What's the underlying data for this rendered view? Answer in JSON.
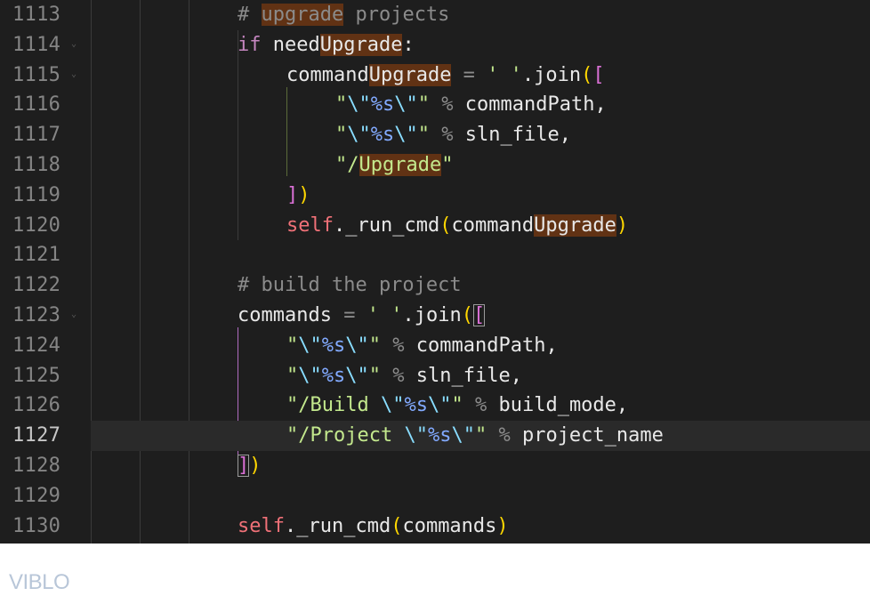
{
  "editor": {
    "colors": {
      "background": "#1e1e1e",
      "comment": "#6a9955",
      "keyword": "#c586c0",
      "string": "#ce9178",
      "escape": "#b5cea8",
      "format": "#9cdcfe",
      "self": "#f44747",
      "identifier": "#d4d4d4",
      "bracket_gold": "#ffd700",
      "bracket_purple": "#da70d6",
      "search_highlight": "#613214"
    },
    "lines": [
      {
        "num": "1113",
        "indent": 4,
        "tokens": [
          {
            "t": "# ",
            "c": "#8b8b8b"
          },
          {
            "t": "upgrade",
            "c": "#8b8b8b",
            "hl": true
          },
          {
            "t": " projects",
            "c": "#8b8b8b"
          }
        ]
      },
      {
        "num": "1114",
        "indent": 4,
        "fold": true,
        "tokens": [
          {
            "t": "if",
            "c": "#c586c0"
          },
          {
            "t": " need",
            "c": "#e8e8e8"
          },
          {
            "t": "Upgrade",
            "c": "#e8e8e8",
            "hl": true
          },
          {
            "t": ":",
            "c": "#e8e8e8"
          }
        ]
      },
      {
        "num": "1115",
        "indent": 8,
        "fold": true,
        "tokens": [
          {
            "t": "command",
            "c": "#e8e8e8"
          },
          {
            "t": "Upgrade",
            "c": "#e8e8e8",
            "hl": true
          },
          {
            "t": " = ",
            "c": "#8b8b8b"
          },
          {
            "t": "' '",
            "c": "#c3e88d"
          },
          {
            "t": ".join",
            "c": "#e8e8e8"
          },
          {
            "t": "(",
            "c": "#ffd700"
          },
          {
            "t": "[",
            "c": "#da70d6"
          }
        ]
      },
      {
        "num": "1116",
        "indent": 12,
        "tokens": [
          {
            "t": "\"",
            "c": "#c3e88d"
          },
          {
            "t": "\\\"",
            "c": "#89ddff"
          },
          {
            "t": "%s",
            "c": "#82aaff"
          },
          {
            "t": "\\\"",
            "c": "#89ddff"
          },
          {
            "t": "\"",
            "c": "#c3e88d"
          },
          {
            "t": " % ",
            "c": "#8b8b8b"
          },
          {
            "t": "commandPath,",
            "c": "#e8e8e8"
          }
        ]
      },
      {
        "num": "1117",
        "indent": 12,
        "tokens": [
          {
            "t": "\"",
            "c": "#c3e88d"
          },
          {
            "t": "\\\"",
            "c": "#89ddff"
          },
          {
            "t": "%s",
            "c": "#82aaff"
          },
          {
            "t": "\\\"",
            "c": "#89ddff"
          },
          {
            "t": "\"",
            "c": "#c3e88d"
          },
          {
            "t": " % ",
            "c": "#8b8b8b"
          },
          {
            "t": "sln_file,",
            "c": "#e8e8e8"
          }
        ]
      },
      {
        "num": "1118",
        "indent": 12,
        "tokens": [
          {
            "t": "\"/",
            "c": "#c3e88d"
          },
          {
            "t": "Upgrade",
            "c": "#c3e88d",
            "hl": true
          },
          {
            "t": "\"",
            "c": "#c3e88d"
          }
        ]
      },
      {
        "num": "1119",
        "indent": 8,
        "tokens": [
          {
            "t": "]",
            "c": "#da70d6"
          },
          {
            "t": ")",
            "c": "#ffd700"
          }
        ]
      },
      {
        "num": "1120",
        "indent": 8,
        "tokens": [
          {
            "t": "self",
            "c": "#f07178"
          },
          {
            "t": "._run_cmd",
            "c": "#e8e8e8"
          },
          {
            "t": "(",
            "c": "#ffd700"
          },
          {
            "t": "command",
            "c": "#e8e8e8"
          },
          {
            "t": "Upgrade",
            "c": "#e8e8e8",
            "hl": true
          },
          {
            "t": ")",
            "c": "#ffd700"
          }
        ]
      },
      {
        "num": "1121",
        "indent": 0,
        "tokens": []
      },
      {
        "num": "1122",
        "indent": 4,
        "tokens": [
          {
            "t": "# build the project",
            "c": "#8b8b8b"
          }
        ]
      },
      {
        "num": "1123",
        "indent": 4,
        "fold": true,
        "tokens": [
          {
            "t": "commands",
            "c": "#e8e8e8"
          },
          {
            "t": " = ",
            "c": "#8b8b8b"
          },
          {
            "t": "' '",
            "c": "#c3e88d"
          },
          {
            "t": ".join",
            "c": "#e8e8e8"
          },
          {
            "t": "(",
            "c": "#ffd700"
          },
          {
            "t": "[",
            "c": "#da70d6",
            "box": true
          }
        ]
      },
      {
        "num": "1124",
        "indent": 8,
        "tokens": [
          {
            "t": "\"",
            "c": "#c3e88d"
          },
          {
            "t": "\\\"",
            "c": "#89ddff"
          },
          {
            "t": "%s",
            "c": "#82aaff"
          },
          {
            "t": "\\\"",
            "c": "#89ddff"
          },
          {
            "t": "\"",
            "c": "#c3e88d"
          },
          {
            "t": " % ",
            "c": "#8b8b8b"
          },
          {
            "t": "commandPath,",
            "c": "#e8e8e8"
          }
        ]
      },
      {
        "num": "1125",
        "indent": 8,
        "tokens": [
          {
            "t": "\"",
            "c": "#c3e88d"
          },
          {
            "t": "\\\"",
            "c": "#89ddff"
          },
          {
            "t": "%s",
            "c": "#82aaff"
          },
          {
            "t": "\\\"",
            "c": "#89ddff"
          },
          {
            "t": "\"",
            "c": "#c3e88d"
          },
          {
            "t": " % ",
            "c": "#8b8b8b"
          },
          {
            "t": "sln_file,",
            "c": "#e8e8e8"
          }
        ]
      },
      {
        "num": "1126",
        "indent": 8,
        "tokens": [
          {
            "t": "\"/Build ",
            "c": "#c3e88d"
          },
          {
            "t": "\\\"",
            "c": "#89ddff"
          },
          {
            "t": "%s",
            "c": "#82aaff"
          },
          {
            "t": "\\\"",
            "c": "#89ddff"
          },
          {
            "t": "\"",
            "c": "#c3e88d"
          },
          {
            "t": " % ",
            "c": "#8b8b8b"
          },
          {
            "t": "build_mode,",
            "c": "#e8e8e8"
          }
        ]
      },
      {
        "num": "1127",
        "indent": 8,
        "current": true,
        "tokens": [
          {
            "t": "\"/Project ",
            "c": "#c3e88d"
          },
          {
            "t": "\\\"",
            "c": "#89ddff"
          },
          {
            "t": "%s",
            "c": "#82aaff"
          },
          {
            "t": "\\\"",
            "c": "#89ddff"
          },
          {
            "t": "\"",
            "c": "#c3e88d"
          },
          {
            "t": " % ",
            "c": "#8b8b8b"
          },
          {
            "t": "project_name",
            "c": "#e8e8e8"
          }
        ]
      },
      {
        "num": "1128",
        "indent": 4,
        "tokens": [
          {
            "t": "]",
            "c": "#da70d6",
            "box": true
          },
          {
            "t": ")",
            "c": "#ffd700"
          }
        ]
      },
      {
        "num": "1129",
        "indent": 0,
        "tokens": []
      },
      {
        "num": "1130",
        "indent": 4,
        "tokens": [
          {
            "t": "self",
            "c": "#f07178"
          },
          {
            "t": "._run_cmd",
            "c": "#e8e8e8"
          },
          {
            "t": "(",
            "c": "#ffd700"
          },
          {
            "t": "commands",
            "c": "#e8e8e8"
          },
          {
            "t": ")",
            "c": "#ffd700"
          }
        ]
      }
    ]
  },
  "footer": {
    "logo_text": "VIBLO",
    "logo_color": "#b8c6d8"
  }
}
